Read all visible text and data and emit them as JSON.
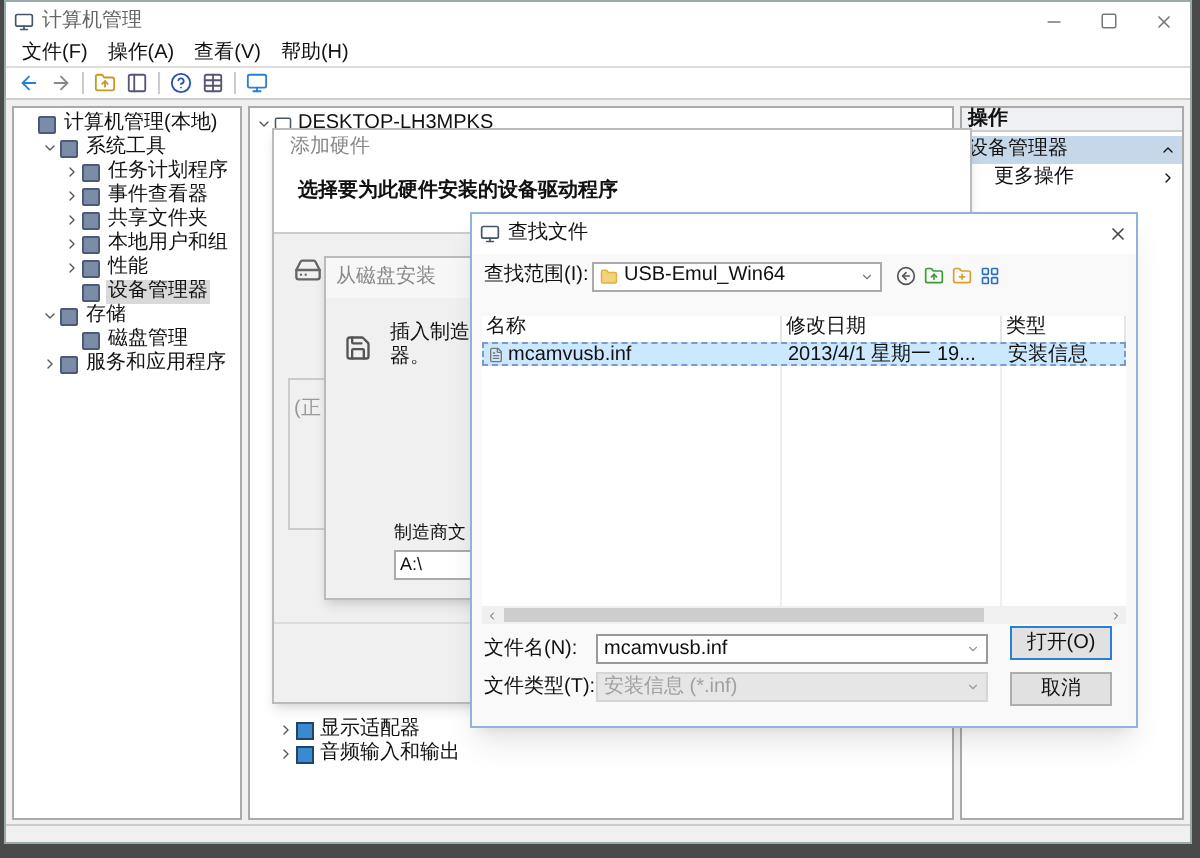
{
  "main_window": {
    "title": "计算机管理"
  },
  "menu": [
    "文件(F)",
    "操作(A)",
    "查看(V)",
    "帮助(H)"
  ],
  "nav_tree": [
    {
      "label": "计算机管理(本地)",
      "selected": false,
      "children": [
        {
          "label": "系统工具",
          "selected": false,
          "expanded": true,
          "children": [
            {
              "label": "任务计划程序",
              "selected": false,
              "expanded": false
            },
            {
              "label": "事件查看器",
              "selected": false,
              "expanded": false
            },
            {
              "label": "共享文件夹",
              "selected": false,
              "expanded": false
            },
            {
              "label": "本地用户和组",
              "selected": false,
              "expanded": false
            },
            {
              "label": "性能",
              "selected": false,
              "expanded": false
            },
            {
              "label": "设备管理器",
              "selected": true
            }
          ]
        },
        {
          "label": "存储",
          "selected": false,
          "expanded": true,
          "children": [
            {
              "label": "磁盘管理",
              "selected": false
            }
          ]
        },
        {
          "label": "服务和应用程序",
          "selected": false,
          "expanded": false
        }
      ]
    }
  ],
  "device_tree": {
    "label": "DESKTOP-LH3MPKS",
    "expanded": true,
    "children": [
      {
        "label": "显示适配器",
        "expanded": false
      },
      {
        "label": "音频输入和输出",
        "expanded": false
      }
    ]
  },
  "actions": {
    "header": "操作",
    "sections": [
      {
        "label": "设备管理器",
        "expanded": true,
        "items": [
          {
            "label": "更多操作"
          }
        ]
      }
    ]
  },
  "add_hardware": {
    "title": "添加硬件",
    "heading": "选择要为此硬件安装的设备驱动程序",
    "group_label": "(正"
  },
  "from_disk": {
    "title": "从磁盘安装",
    "message_lines": [
      "插入制造",
      "器。"
    ],
    "path_label": "制造商文",
    "path_value": "A:\\"
  },
  "find_file": {
    "title": "查找文件",
    "look_in_label": "查找范围(I):",
    "look_in_value": "USB-Emul_Win64",
    "columns": [
      "名称",
      "修改日期",
      "类型"
    ],
    "rows": [
      {
        "cells": [
          "mcamvusb.inf",
          "2013/4/1 星期一 19...",
          "安装信息"
        ],
        "selected": true
      }
    ],
    "file_name": {
      "label": "文件名(N):",
      "value": "mcamvusb.inf",
      "disabled": false
    },
    "file_type": {
      "label": "文件类型(T):",
      "value": "安装信息 (*.inf)",
      "disabled": true
    },
    "buttons": [
      {
        "label": "打开(O)",
        "default": true
      },
      {
        "label": "取消",
        "default": false
      }
    ]
  }
}
